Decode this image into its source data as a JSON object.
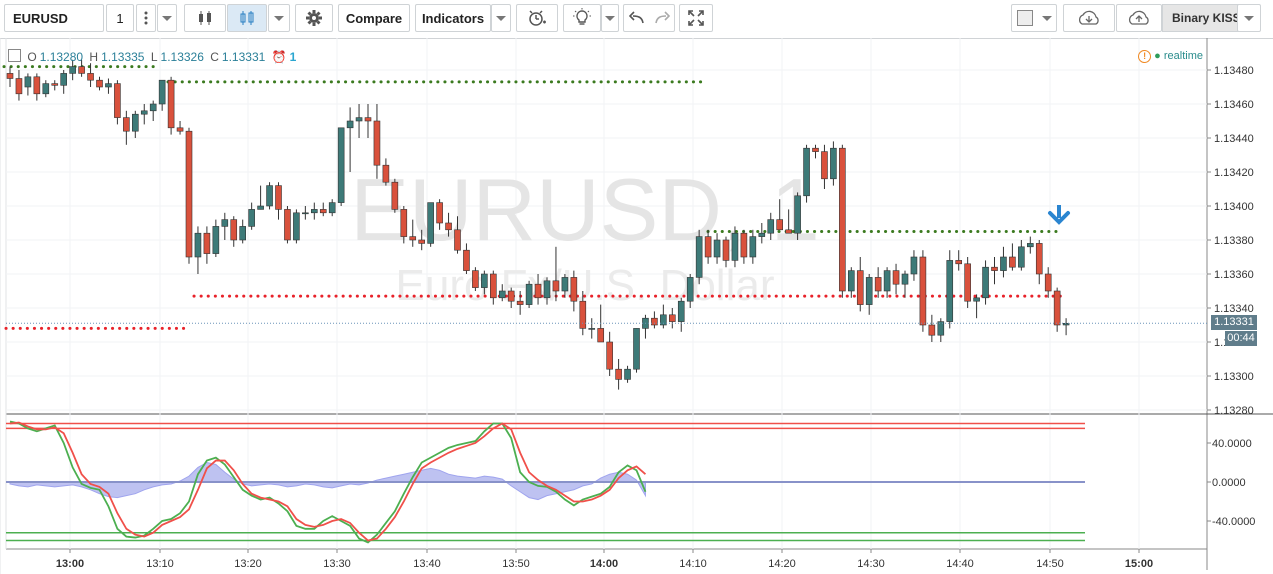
{
  "toolbar": {
    "symbol": "EURUSD",
    "interval": "1",
    "compare_label": "Compare",
    "indicators_label": "Indicators",
    "brand_label": "Binary KISS"
  },
  "legend": {
    "o_label": "O",
    "o_value": "1.13280",
    "h_label": "H",
    "h_value": "1.13335",
    "l_label": "L",
    "l_value": "1.13326",
    "c_label": "C",
    "c_value": "1.13331",
    "alert_count": "1"
  },
  "status": {
    "realtime": "realtime"
  },
  "watermark": {
    "symbol": "EURUSD, 1",
    "description": "Euro Fx/U.S. Dollar"
  },
  "price_axis": {
    "ticks": [
      "1.13480",
      "1.13460",
      "1.13440",
      "1.13420",
      "1.13400",
      "1.13380",
      "1.13360",
      "1.13340",
      "1.13320",
      "1.13300",
      "1.13280"
    ],
    "current_price": "1.13331",
    "countdown": "00:44"
  },
  "osc_axis": {
    "ticks": [
      "40.0000",
      "0.0000",
      "-40.0000"
    ]
  },
  "time_axis": {
    "ticks": [
      "13:00",
      "13:10",
      "13:20",
      "13:30",
      "13:40",
      "13:50",
      "14:00",
      "14:10",
      "14:20",
      "14:30",
      "14:40",
      "14:50",
      "15:00"
    ],
    "bold": [
      "13:00",
      "14:00",
      "15:00"
    ]
  },
  "colors": {
    "up": "#3d7a78",
    "down": "#d9513c",
    "dotted_red": "#e8222a",
    "dotted_green": "#3b7a1f",
    "osc_red": "#f0504a",
    "osc_green": "#4caf50",
    "histogram": "#b3b7ee",
    "accent": "#2196f3"
  },
  "chart_data": {
    "type": "candlestick",
    "interval": "1 minute",
    "ylim": [
      1.1328,
      1.1349
    ],
    "candles_ohlc": [
      [
        1.13478,
        1.13482,
        1.1347,
        1.13475
      ],
      [
        1.13475,
        1.1348,
        1.13462,
        1.13466
      ],
      [
        1.1347,
        1.13478,
        1.13465,
        1.13476
      ],
      [
        1.13476,
        1.13478,
        1.13462,
        1.13466
      ],
      [
        1.13466,
        1.13474,
        1.13464,
        1.13472
      ],
      [
        1.13472,
        1.13474,
        1.13468,
        1.13471
      ],
      [
        1.13471,
        1.1348,
        1.13466,
        1.13478
      ],
      [
        1.13478,
        1.13486,
        1.13474,
        1.13482
      ],
      [
        1.13482,
        1.13486,
        1.13476,
        1.13478
      ],
      [
        1.13478,
        1.13484,
        1.1347,
        1.13474
      ],
      [
        1.13474,
        1.13476,
        1.13468,
        1.1347
      ],
      [
        1.1347,
        1.13475,
        1.13466,
        1.13472
      ],
      [
        1.13472,
        1.13474,
        1.13448,
        1.13452
      ],
      [
        1.13452,
        1.13456,
        1.13436,
        1.13444
      ],
      [
        1.13444,
        1.13456,
        1.1344,
        1.13454
      ],
      [
        1.13454,
        1.1346,
        1.13448,
        1.13456
      ],
      [
        1.13456,
        1.13462,
        1.1345,
        1.1346
      ],
      [
        1.1346,
        1.13474,
        1.13456,
        1.13474
      ],
      [
        1.13474,
        1.13476,
        1.13442,
        1.13446
      ],
      [
        1.13446,
        1.1345,
        1.13442,
        1.13444
      ],
      [
        1.13444,
        1.13446,
        1.13366,
        1.1337
      ],
      [
        1.1337,
        1.13388,
        1.1336,
        1.13384
      ],
      [
        1.13384,
        1.13388,
        1.13366,
        1.13372
      ],
      [
        1.13372,
        1.13392,
        1.1337,
        1.13388
      ],
      [
        1.13388,
        1.13396,
        1.1338,
        1.13392
      ],
      [
        1.13392,
        1.13394,
        1.13376,
        1.1338
      ],
      [
        1.1338,
        1.13392,
        1.13378,
        1.13388
      ],
      [
        1.13388,
        1.13402,
        1.13386,
        1.13398
      ],
      [
        1.13398,
        1.13412,
        1.13398,
        1.134
      ],
      [
        1.134,
        1.13414,
        1.13398,
        1.13412
      ],
      [
        1.13412,
        1.13414,
        1.13392,
        1.13398
      ],
      [
        1.13398,
        1.134,
        1.13378,
        1.1338
      ],
      [
        1.1338,
        1.13398,
        1.13378,
        1.13396
      ],
      [
        1.13396,
        1.134,
        1.13392,
        1.13396
      ],
      [
        1.13396,
        1.13402,
        1.13392,
        1.13398
      ],
      [
        1.13398,
        1.13402,
        1.13394,
        1.13396
      ],
      [
        1.13396,
        1.13404,
        1.13394,
        1.13402
      ],
      [
        1.13402,
        1.13412,
        1.134,
        1.13446
      ],
      [
        1.13446,
        1.13458,
        1.1342,
        1.1345
      ],
      [
        1.1345,
        1.1346,
        1.1344,
        1.13452
      ],
      [
        1.13452,
        1.1346,
        1.1344,
        1.1345
      ],
      [
        1.1345,
        1.1346,
        1.13416,
        1.13424
      ],
      [
        1.13424,
        1.13428,
        1.13412,
        1.13414
      ],
      [
        1.13414,
        1.13416,
        1.13396,
        1.13398
      ],
      [
        1.13398,
        1.134,
        1.13378,
        1.13382
      ],
      [
        1.13382,
        1.13392,
        1.13376,
        1.1338
      ],
      [
        1.1338,
        1.13386,
        1.13374,
        1.13378
      ],
      [
        1.13378,
        1.134,
        1.13376,
        1.13402
      ],
      [
        1.13402,
        1.13404,
        1.13386,
        1.1339
      ],
      [
        1.1339,
        1.13396,
        1.13382,
        1.13386
      ],
      [
        1.13386,
        1.13394,
        1.13372,
        1.13374
      ],
      [
        1.13374,
        1.13378,
        1.1336,
        1.13362
      ],
      [
        1.13362,
        1.13364,
        1.1335,
        1.13352
      ],
      [
        1.13352,
        1.13362,
        1.13348,
        1.1336
      ],
      [
        1.1336,
        1.13362,
        1.13342,
        1.13346
      ],
      [
        1.13346,
        1.13354,
        1.13344,
        1.1335
      ],
      [
        1.1335,
        1.13352,
        1.1334,
        1.13344
      ],
      [
        1.13344,
        1.1335,
        1.13336,
        1.13342
      ],
      [
        1.13342,
        1.13356,
        1.1334,
        1.13354
      ],
      [
        1.13354,
        1.1336,
        1.13342,
        1.13346
      ],
      [
        1.13346,
        1.13358,
        1.13342,
        1.13356
      ],
      [
        1.13356,
        1.13376,
        1.13344,
        1.1335
      ],
      [
        1.1335,
        1.1336,
        1.13346,
        1.13358
      ],
      [
        1.13358,
        1.13362,
        1.13338,
        1.13344
      ],
      [
        1.13344,
        1.1335,
        1.13324,
        1.13328
      ],
      [
        1.13328,
        1.13334,
        1.13322,
        1.13328
      ],
      [
        1.13328,
        1.13342,
        1.13322,
        1.1332
      ],
      [
        1.1332,
        1.13326,
        1.133,
        1.13304
      ],
      [
        1.13304,
        1.1331,
        1.13292,
        1.13298
      ],
      [
        1.13298,
        1.13306,
        1.13296,
        1.13304
      ],
      [
        1.13304,
        1.13328,
        1.13302,
        1.13328
      ],
      [
        1.13328,
        1.13336,
        1.13322,
        1.13334
      ],
      [
        1.13334,
        1.13338,
        1.13328,
        1.1333
      ],
      [
        1.1333,
        1.13342,
        1.13328,
        1.13336
      ],
      [
        1.13336,
        1.1334,
        1.13328,
        1.13332
      ],
      [
        1.13332,
        1.13346,
        1.13326,
        1.13344
      ],
      [
        1.13344,
        1.1336,
        1.1334,
        1.13358
      ],
      [
        1.13358,
        1.13386,
        1.13354,
        1.13382
      ],
      [
        1.13382,
        1.13386,
        1.13366,
        1.1337
      ],
      [
        1.1337,
        1.13384,
        1.13366,
        1.1338
      ],
      [
        1.1338,
        1.13382,
        1.13364,
        1.13368
      ],
      [
        1.13368,
        1.13388,
        1.13364,
        1.13384
      ],
      [
        1.13384,
        1.13386,
        1.13366,
        1.1337
      ],
      [
        1.1337,
        1.13386,
        1.13366,
        1.13382
      ],
      [
        1.13382,
        1.1339,
        1.13378,
        1.13384
      ],
      [
        1.13384,
        1.13396,
        1.1338,
        1.13392
      ],
      [
        1.13392,
        1.13404,
        1.13388,
        1.13386
      ],
      [
        1.13386,
        1.13398,
        1.13384,
        1.13384
      ],
      [
        1.13384,
        1.13408,
        1.1338,
        1.13406
      ],
      [
        1.13406,
        1.13436,
        1.13402,
        1.13434
      ],
      [
        1.13434,
        1.13436,
        1.13428,
        1.13432
      ],
      [
        1.13432,
        1.13436,
        1.1341,
        1.13416
      ],
      [
        1.13416,
        1.13438,
        1.13412,
        1.13434
      ],
      [
        1.13434,
        1.13436,
        1.13346,
        1.1335
      ],
      [
        1.1335,
        1.13364,
        1.13346,
        1.13362
      ],
      [
        1.13362,
        1.1337,
        1.13338,
        1.13342
      ],
      [
        1.13342,
        1.1336,
        1.13336,
        1.13358
      ],
      [
        1.13358,
        1.13364,
        1.13346,
        1.1335
      ],
      [
        1.1335,
        1.13364,
        1.13346,
        1.13362
      ],
      [
        1.13362,
        1.13366,
        1.13348,
        1.13354
      ],
      [
        1.13354,
        1.13362,
        1.13346,
        1.1336
      ],
      [
        1.1336,
        1.13374,
        1.13356,
        1.1337
      ],
      [
        1.1337,
        1.13374,
        1.13326,
        1.1333
      ],
      [
        1.1333,
        1.13336,
        1.1332,
        1.13324
      ],
      [
        1.13324,
        1.13334,
        1.1332,
        1.13332
      ],
      [
        1.13332,
        1.13374,
        1.13328,
        1.13368
      ],
      [
        1.13368,
        1.13374,
        1.13362,
        1.13366
      ],
      [
        1.13366,
        1.1337,
        1.1334,
        1.13344
      ],
      [
        1.13344,
        1.13348,
        1.13334,
        1.13346
      ],
      [
        1.13346,
        1.13368,
        1.13342,
        1.13364
      ],
      [
        1.13364,
        1.1337,
        1.13354,
        1.13362
      ],
      [
        1.13362,
        1.13376,
        1.13358,
        1.1337
      ],
      [
        1.1337,
        1.13378,
        1.13362,
        1.13364
      ],
      [
        1.13364,
        1.1338,
        1.13362,
        1.13376
      ],
      [
        1.13376,
        1.13382,
        1.13372,
        1.13378
      ],
      [
        1.13378,
        1.1338,
        1.13354,
        1.1336
      ],
      [
        1.1336,
        1.13364,
        1.13346,
        1.1335
      ],
      [
        1.1335,
        1.13352,
        1.13326,
        1.1333
      ],
      [
        1.1333,
        1.13334,
        1.13324,
        1.13331
      ]
    ],
    "resistance_levels": [
      1.13473,
      1.13385
    ],
    "support_levels": [
      1.13347,
      1.13328
    ],
    "oscillator": {
      "ylim": [
        -60,
        65
      ],
      "levels_red": [
        60,
        55
      ],
      "levels_green": [
        -52,
        -60
      ],
      "series_green": [
        62,
        60,
        55,
        52,
        55,
        58,
        40,
        15,
        -2,
        -6,
        -8,
        -25,
        -48,
        -56,
        -57,
        -55,
        -48,
        -40,
        -38,
        -32,
        -20,
        8,
        22,
        25,
        18,
        5,
        -8,
        -14,
        -18,
        -16,
        -22,
        -30,
        -45,
        -48,
        -48,
        -40,
        -35,
        -40,
        -45,
        -58,
        -62,
        -54,
        -42,
        -30,
        -12,
        5,
        20,
        25,
        30,
        35,
        38,
        40,
        42,
        52,
        60,
        60,
        45,
        10,
        0,
        -4,
        -5,
        -10,
        -18,
        -24,
        -18,
        -15,
        -12,
        -5,
        10,
        17,
        12,
        -10
      ],
      "series_red": [
        60,
        61,
        57,
        54,
        54,
        56,
        50,
        30,
        8,
        -2,
        -5,
        -12,
        -32,
        -48,
        -54,
        -56,
        -52,
        -44,
        -40,
        -36,
        -28,
        -8,
        14,
        22,
        22,
        12,
        -2,
        -12,
        -16,
        -18,
        -20,
        -25,
        -38,
        -44,
        -46,
        -44,
        -40,
        -38,
        -42,
        -52,
        -60,
        -58,
        -48,
        -36,
        -20,
        -2,
        14,
        20,
        25,
        30,
        34,
        37,
        40,
        47,
        55,
        60,
        54,
        30,
        10,
        2,
        -4,
        -8,
        -14,
        -20,
        -20,
        -18,
        -14,
        -8,
        4,
        12,
        16,
        8
      ]
    }
  }
}
